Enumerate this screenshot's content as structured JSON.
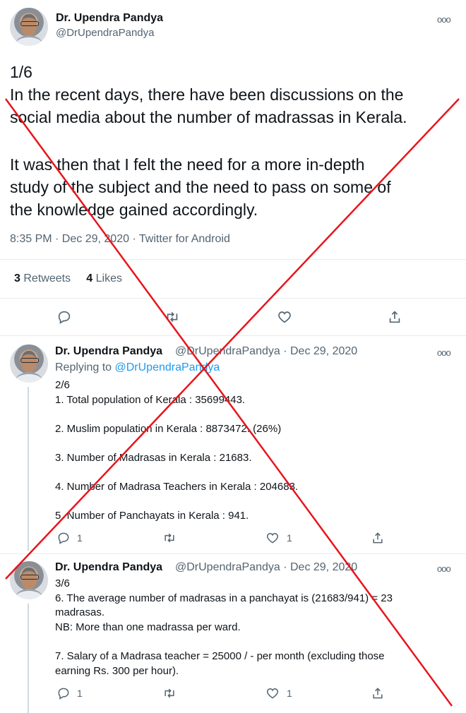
{
  "main_tweet": {
    "author_name": "Dr. Upendra Pandya",
    "author_handle": "@DrUpendraPandya",
    "lines": [
      "1/6",
      "In the recent days, there have been discussions on the",
      "social media about the number of madrassas in Kerala.",
      "",
      "It was then that I felt the need for a more in-depth",
      "study of the subject and the need to pass on some of",
      "the knowledge gained accordingly."
    ],
    "time": "8:35 PM · Dec 29, 2020 · Twitter for Android",
    "retweets_count": "3",
    "retweets_label": "Retweets",
    "likes_count": "4",
    "likes_label": "Likes"
  },
  "reply_1": {
    "author_name": "Dr. Upendra Pandya",
    "author_meta": "@DrUpendraPandya · Dec 29, 2020",
    "replying_label": "Replying to",
    "replying_to": "@DrUpendraPandya",
    "text": "2/6\n1. Total population of Kerala : 35699443.\n\n2. Muslim population in Kerala : 8873472. (26%)\n\n3. Number of Madrasas in Kerala : 21683.\n\n4. Number of Madrasa Teachers in Kerala : 204683.\n\n5. Number of Panchayats in Kerala : 941.",
    "reply_count": "1",
    "like_count": "1"
  },
  "reply_2": {
    "author_name": "Dr. Upendra Pandya",
    "author_meta": "@DrUpendraPandya · Dec 29, 2020",
    "text": "3/6\n6. The average number of madrasas in a panchayat is (21683/941) = 23\nmadrasas.\nNB: More than one madrassa per ward.\n\n7. Salary of a Madrasa teacher = 25000 / - per month (excluding those\nearning Rs. 300 per hour).",
    "reply_count": "1",
    "like_count": "1"
  },
  "colors": {
    "cross": "#e8141c",
    "link": "#1d9bf0",
    "muted": "#536471"
  },
  "icons": [
    "reply-icon",
    "retweet-icon",
    "like-icon",
    "share-icon",
    "more-icon"
  ]
}
